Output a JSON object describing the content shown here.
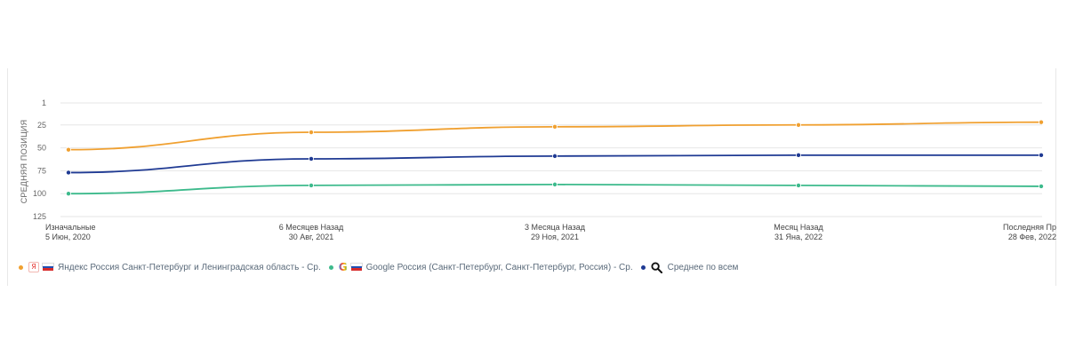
{
  "colors": {
    "yandex": "#f0a030",
    "google": "#3dba8c",
    "average": "#1f3a93",
    "grid": "#e6e6e6",
    "flag_white": "#ffffff",
    "flag_blue": "#1e4fb3",
    "flag_red": "#d62b2b"
  },
  "chart_data": {
    "type": "line",
    "ylabel": "СРЕДНЯЯ ПОЗИЦИЯ",
    "y_ticks": [
      "1",
      "25",
      "50",
      "75",
      "100",
      "125"
    ],
    "y_tick_values": [
      1,
      25,
      50,
      75,
      100,
      125
    ],
    "ylim": [
      1,
      125
    ],
    "y_reversed": true,
    "grid": true,
    "legend_position": "bottom",
    "categories": [
      {
        "line1": "Изначальные",
        "line2": "5 Июн, 2020"
      },
      {
        "line1": "6 Месяцев Назад",
        "line2": "30 Авг, 2021"
      },
      {
        "line1": "3 Месяца Назад",
        "line2": "29 Ноя, 2021"
      },
      {
        "line1": "Месяц Назад",
        "line2": "31 Яна, 2022"
      },
      {
        "line1": "Последняя Пр",
        "line2": "28 Фев, 2022"
      }
    ],
    "series": [
      {
        "name": "Яндекс Россия Санкт-Петербург и Ленинградская область - Ср.",
        "key": "yandex",
        "values": [
          52,
          33,
          27,
          25,
          22
        ]
      },
      {
        "name": "Google Россия (Санкт-Петербург, Санкт-Петербург, Россия) - Ср.",
        "key": "google",
        "values": [
          100,
          91,
          90,
          91,
          92
        ]
      },
      {
        "name": "Среднее по всем",
        "key": "average",
        "values": [
          77,
          62,
          59,
          58,
          58
        ]
      }
    ]
  },
  "legend": {
    "yandex_icon": "Я",
    "google_icon": "G",
    "yandex_label": "Яндекс Россия Санкт-Петербург и Ленинградская область - Ср.",
    "google_label": "Google Россия (Санкт-Петербург, Санкт-Петербург, Россия) - Ср.",
    "average_label": "Среднее по всем"
  }
}
